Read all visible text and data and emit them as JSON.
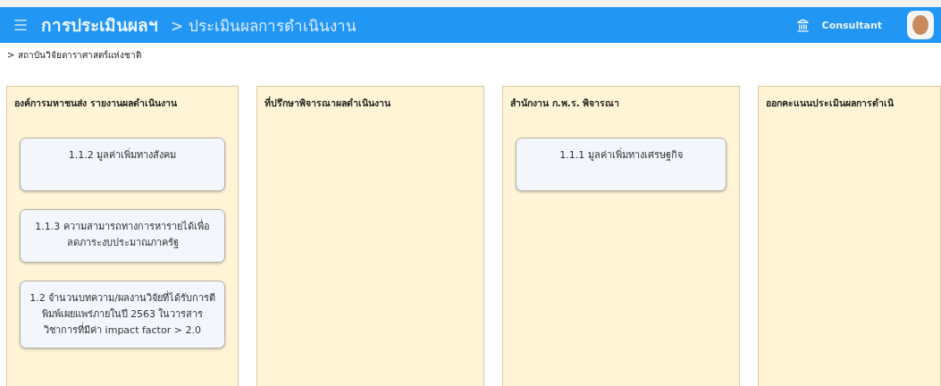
{
  "header": {
    "title": "การประเมินผลฯ",
    "breadcrumb": "> ประเมินผลการดำเนินงาน",
    "user": "Consultant"
  },
  "sub_breadcrumb": "> สถาบันวิจัยดาราศาสตร์แห่งชาติ",
  "columns": [
    {
      "title": "องค์การมหาชนส่ง รายงานผลดำเนินงาน",
      "cards": [
        "1.1.2 มูลค่าเพิ่มทางสังคม",
        "1.1.3 ความสามารถทางการหารายได้เพื่อลดภาระงบประมาณภาครัฐ",
        "1.2 จำนวนบทความ/ผลงานวิจัยที่ได้รับการตีพิมพ์เผยแพร่ภายในปี 2563 ในวารสารวิชาการที่มีค่า impact factor > 2.0"
      ]
    },
    {
      "title": "ที่ปรึกษาพิจารณาผลดำเนินงาน"
    },
    {
      "title": "สำนักงาน ก.พ.ร. พิจารณา",
      "cards": [
        "1.1.1 มูลค่าเพิ่มทางเศรษฐกิจ"
      ]
    },
    {
      "title": "ออกคะแนนประเมินผลการดำเนิ"
    }
  ]
}
